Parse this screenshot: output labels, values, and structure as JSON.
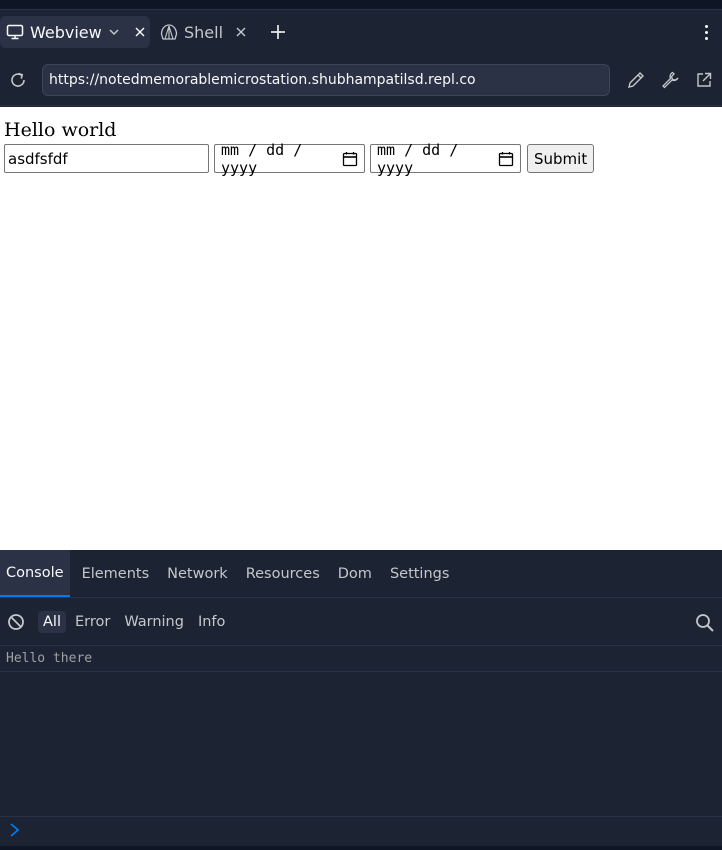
{
  "tabs": [
    {
      "label": "Webview",
      "icon": "monitor-icon",
      "active": true
    },
    {
      "label": "Shell",
      "icon": "shell-icon",
      "active": false
    }
  ],
  "url": {
    "value": "https://notedmemorablemicrostation.shubhampatilsd.repl.co"
  },
  "webview": {
    "title": "Hello world",
    "text_value": "asdfsfdf",
    "date1_placeholder": "mm / dd / yyyy",
    "date2_placeholder": "mm / dd / yyyy",
    "submit_label": "Submit"
  },
  "devtools": {
    "tabs": [
      "Console",
      "Elements",
      "Network",
      "Resources",
      "Dom",
      "Settings"
    ],
    "filters": [
      "All",
      "Error",
      "Warning",
      "Info"
    ],
    "logs": [
      "Hello there"
    ]
  },
  "colors": {
    "accent": "#0079f2",
    "panel_bg": "#1c2333",
    "surface": "#2b3245"
  }
}
